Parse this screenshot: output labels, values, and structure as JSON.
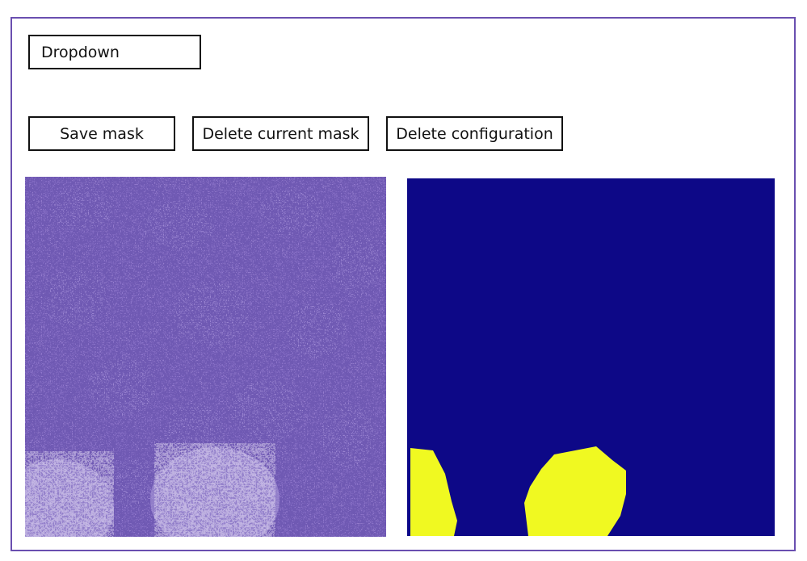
{
  "dropdown": {
    "label": "Dropdown"
  },
  "buttons": {
    "save": "Save mask",
    "delete_mask": "Delete current mask",
    "delete_config": "Delete configuration"
  },
  "images": {
    "tissue": {
      "icon": "histology-image",
      "base_color": "#8a6fc8"
    },
    "mask": {
      "icon": "segmentation-mask",
      "background_color": "#0d0887",
      "region_color": "#f0f921"
    }
  }
}
